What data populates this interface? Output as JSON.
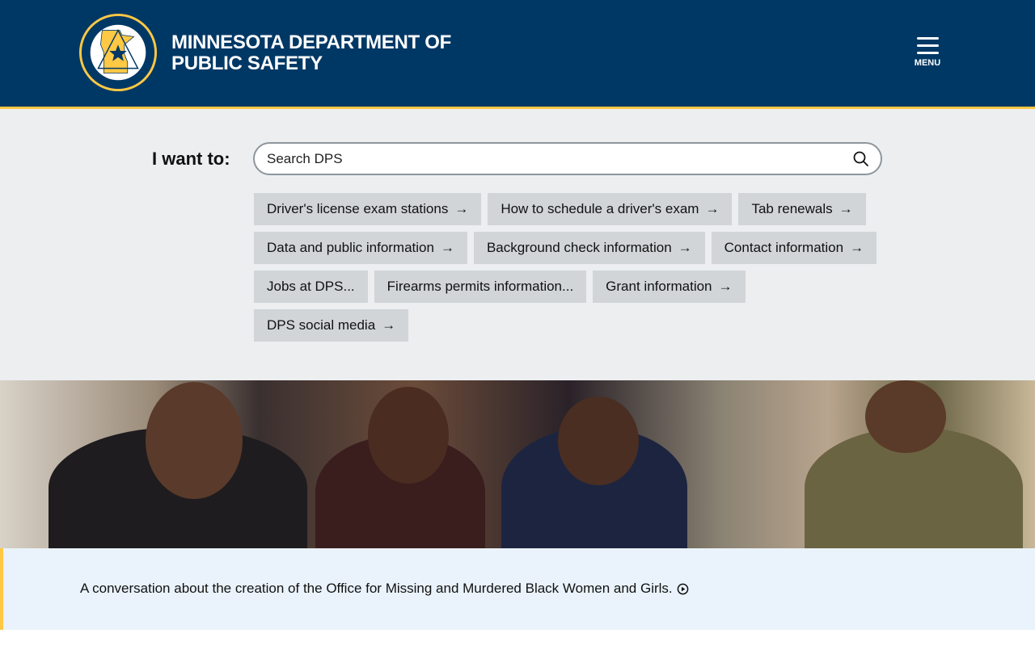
{
  "header": {
    "logo_text": "DEPARTMENT OF PUBLIC SAFETY · STATE OF MINNESOTA",
    "title_line1": "MINNESOTA DEPARTMENT OF",
    "title_line2": "PUBLIC SAFETY",
    "menu_label": "MENU"
  },
  "search": {
    "label": "I want to:",
    "placeholder": "Search DPS"
  },
  "quick_links": [
    {
      "label": "Driver's license exam stations",
      "arrow": "→"
    },
    {
      "label": "How to schedule a driver's exam",
      "arrow": "→"
    },
    {
      "label": "Tab renewals",
      "arrow": "→"
    },
    {
      "label": "Data and public information",
      "arrow": "→"
    },
    {
      "label": "Background check information",
      "arrow": "→"
    },
    {
      "label": "Contact information",
      "arrow": "→"
    },
    {
      "label": "Jobs at DPS...",
      "arrow": ""
    },
    {
      "label": "Firearms permits information...",
      "arrow": ""
    },
    {
      "label": "Grant information",
      "arrow": "→"
    },
    {
      "label": "DPS social media",
      "arrow": "→"
    }
  ],
  "hero": {
    "caption": "A conversation about the creation of the Office for Missing and Murdered Black Women and Girls."
  },
  "colors": {
    "navy": "#003865",
    "gold": "#ffc845",
    "chip": "#d1d5d8"
  }
}
